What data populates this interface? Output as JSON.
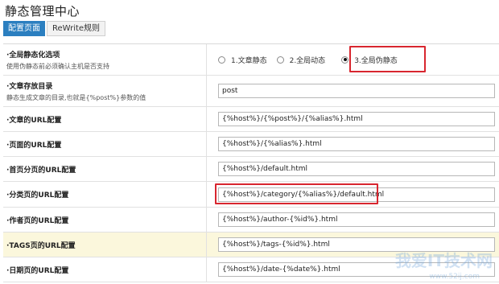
{
  "page": {
    "title": "静态管理中心"
  },
  "tabs": [
    {
      "label": "配置页面",
      "active": true
    },
    {
      "label": "ReWrite规则",
      "active": false
    }
  ],
  "rows": {
    "mode": {
      "label": "·全局静态化选项",
      "desc": "使用伪静态前必须确认主机是否支持",
      "options": [
        "1.文章静态",
        "2.全局动态",
        "3.全局伪静态"
      ],
      "selected": "3.全局伪静态"
    },
    "dir": {
      "label": "·文章存放目录",
      "desc": "静态生成文章的目录,也就是{%post%}参数的值",
      "value": "post"
    },
    "article": {
      "label": "·文章的URL配置",
      "value": "{%host%}/{%post%}/{%alias%}.html"
    },
    "page": {
      "label": "·页面的URL配置",
      "value": "{%host%}/{%alias%}.html"
    },
    "home": {
      "label": "·首页分页的URL配置",
      "value": "{%host%}/default.html"
    },
    "category": {
      "label": "·分类页的URL配置",
      "value": "{%host%}/category/{%alias%}/default.html"
    },
    "author": {
      "label": "·作者页的URL配置",
      "value": "{%host%}/author-{%id%}.html"
    },
    "tags": {
      "label": "·TAGS页的URL配置",
      "value": "{%host%}/tags-{%id%}.html"
    },
    "date": {
      "label": "·日期页的URL配置",
      "value": "{%host%}/date-{%date%}.html"
    }
  },
  "watermark": {
    "text": "我爱IT技术网",
    "url": "www.52ij.com"
  },
  "colors": {
    "accent": "#2b7fc0",
    "highlight_box": "#d8262f",
    "highlight_row": "#fbf7dc"
  }
}
